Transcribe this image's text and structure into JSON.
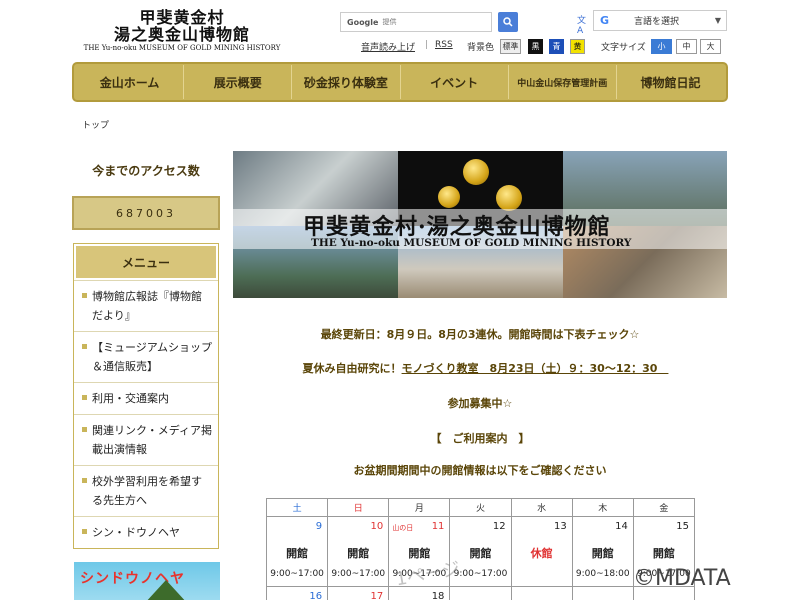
{
  "header": {
    "title_line1": "甲斐黄金村",
    "title_line2": "湯之奥金山博物館",
    "title_en": "THE Yu-no-oku MUSEUM OF GOLD MINING HISTORY",
    "search_brand": "Google",
    "search_placeholder": "提供",
    "language_label": "言語を選択",
    "read_aloud": "音声読み上げ",
    "rss": "RSS",
    "bg_color_label": "背景色",
    "bg_standard": "標準",
    "bg_black": "黒",
    "bg_blue": "青",
    "bg_yellow": "黄",
    "font_size_label": "文字サイズ",
    "font_small": "小",
    "font_medium": "中",
    "font_large": "大"
  },
  "nav": {
    "items": [
      {
        "label": "金山ホーム"
      },
      {
        "label": "展示概要"
      },
      {
        "label": "砂金採り体験室"
      },
      {
        "label": "イベント"
      },
      {
        "label": "中山金山保存管理計画"
      },
      {
        "label": "博物館日記"
      }
    ]
  },
  "breadcrumb": "トップ",
  "sidebar": {
    "access_title": "今までのアクセス数",
    "access_count": "687003",
    "menu_title": "メニュー",
    "menu_items": [
      {
        "label": "博物館広報誌『博物館だより』"
      },
      {
        "label": "【ミュージアムショップ＆通信販売】"
      },
      {
        "label": "利用・交通案内"
      },
      {
        "label": "関連リンク・メディア掲載出演情報"
      },
      {
        "label": "校外学習利用を希望する先生方へ"
      },
      {
        "label": "シン・ドウノヘヤ"
      }
    ],
    "banner_text": "シンドウノヘヤ"
  },
  "hero": {
    "title_jp": "甲斐黄金村·湯之奥金山博物館",
    "title_en": "THE Yu-no-oku MUSEUM OF GOLD MINING HISTORY"
  },
  "notices": {
    "line1": "最終更新日：8月９日。8月の3連休。開館時間は下表チェック☆",
    "line2_prefix": "夏休み自由研究に！",
    "line2_link": "モノづくり教室　8月23日（土）９：30〜12：30　",
    "line3": "参加募集中☆",
    "line4": "【　ご利用案内　】",
    "line5": "お盆期間期間中の開館情報は以下をご確認ください"
  },
  "calendar": {
    "headers": [
      "土",
      "日",
      "月",
      "火",
      "水",
      "木",
      "金"
    ],
    "days": [
      {
        "date": "9",
        "status": "開館",
        "hours": "9:00~17:00",
        "holiday": ""
      },
      {
        "date": "10",
        "status": "開館",
        "hours": "9:00~17:00",
        "holiday": ""
      },
      {
        "date": "11",
        "status": "開館",
        "hours": "9:00~17:00",
        "holiday": "山の日"
      },
      {
        "date": "12",
        "status": "開館",
        "hours": "9:00~17:00",
        "holiday": ""
      },
      {
        "date": "13",
        "status": "休館",
        "hours": "",
        "holiday": ""
      },
      {
        "date": "14",
        "status": "開館",
        "hours": "9:00~18:00",
        "holiday": ""
      },
      {
        "date": "15",
        "status": "開館",
        "hours": "9:00~17:00",
        "holiday": ""
      }
    ],
    "next_row": [
      "16",
      "17",
      "18",
      "",
      "",
      "",
      ""
    ]
  },
  "overlays": {
    "page_watermark": "1ページ",
    "copyright": "©MDATA"
  }
}
